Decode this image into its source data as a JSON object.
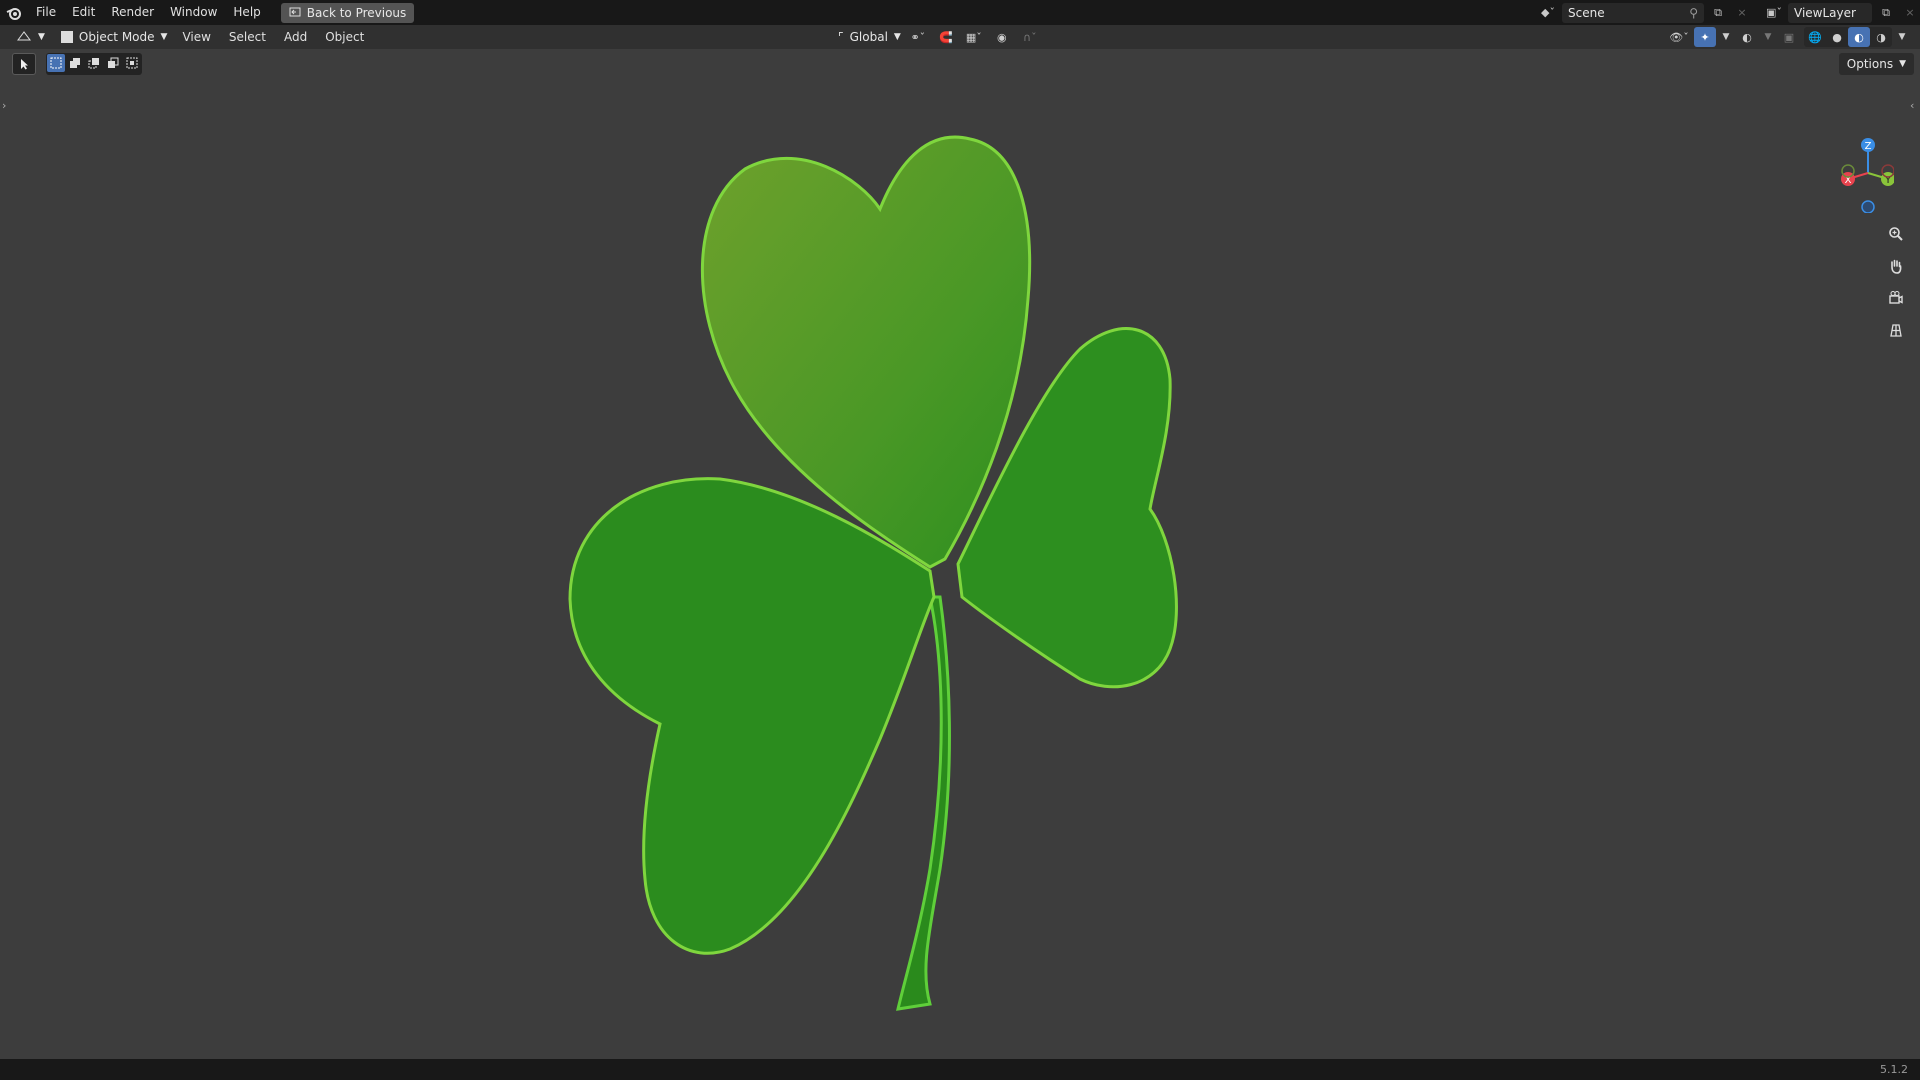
{
  "topbar": {
    "menus": [
      "File",
      "Edit",
      "Render",
      "Window",
      "Help"
    ],
    "back_button": "Back to Previous",
    "scene_name": "Scene",
    "view_layer": "ViewLayer"
  },
  "header": {
    "mode": "Object Mode",
    "menus": [
      "View",
      "Select",
      "Add",
      "Object"
    ],
    "transform_orientation": "Global",
    "options_label": "Options"
  },
  "gizmo": {
    "x_label": "X",
    "y_label": "Y",
    "z_label": "Z"
  },
  "icons": {
    "blender_logo": "blender-logo-icon",
    "back": "back-arrow-icon",
    "scene": "scene-icon",
    "pin": "pin-icon",
    "new_scene": "new-scene-icon",
    "view_layer": "view-layer-icon",
    "editor_type": "3d-view-icon",
    "zoom": "zoom-icon",
    "pan": "hand-icon",
    "camera": "camera-icon",
    "grid": "grid-view-icon"
  },
  "colors": {
    "accent": "#4772b3",
    "shamrock_main": "#2d8f1f",
    "shamrock_light": "#6fa12c",
    "axis_x": "#e8434e",
    "axis_y": "#8ac43a",
    "axis_z": "#3a8ee6"
  },
  "status": {
    "version": "5.1.2"
  }
}
